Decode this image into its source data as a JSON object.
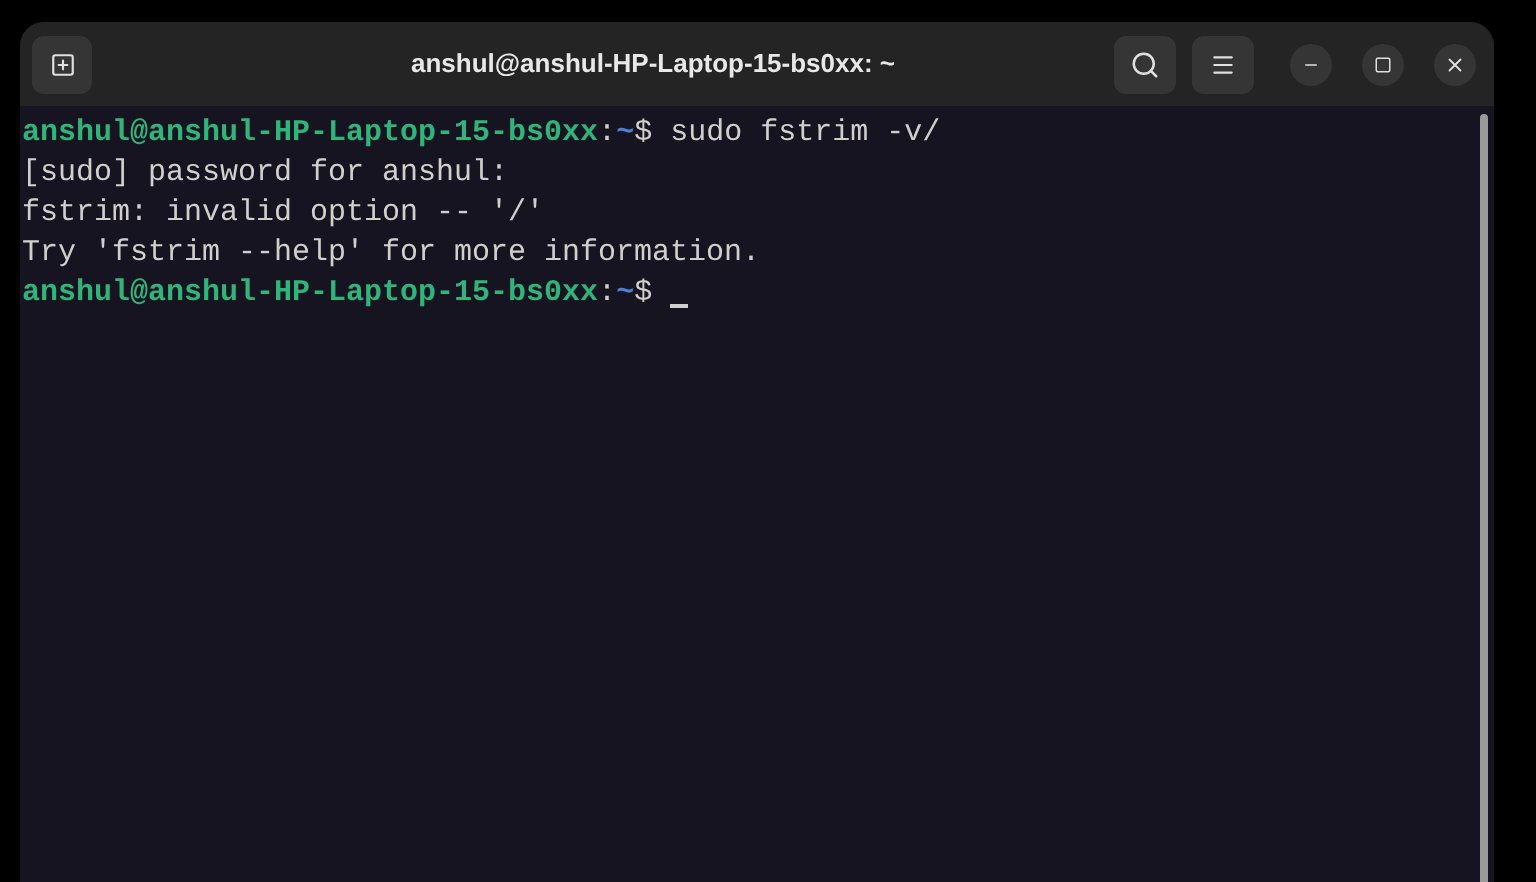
{
  "window": {
    "title": "anshul@anshul-HP-Laptop-15-bs0xx: ~"
  },
  "terminal": {
    "lines": [
      {
        "kind": "prompt",
        "user_host": "anshul@anshul-HP-Laptop-15-bs0xx",
        "separator": ":",
        "path": "~",
        "symbol": "$",
        "command": "sudo fstrim -v/",
        "cursor": false
      },
      {
        "kind": "output",
        "text": "[sudo] password for anshul:"
      },
      {
        "kind": "output",
        "text": "fstrim: invalid option -- '/'"
      },
      {
        "kind": "output",
        "text": "Try 'fstrim --help' for more information."
      },
      {
        "kind": "prompt",
        "user_host": "anshul@anshul-HP-Laptop-15-bs0xx",
        "separator": ":",
        "path": "~",
        "symbol": "$",
        "cursor": true
      }
    ]
  }
}
